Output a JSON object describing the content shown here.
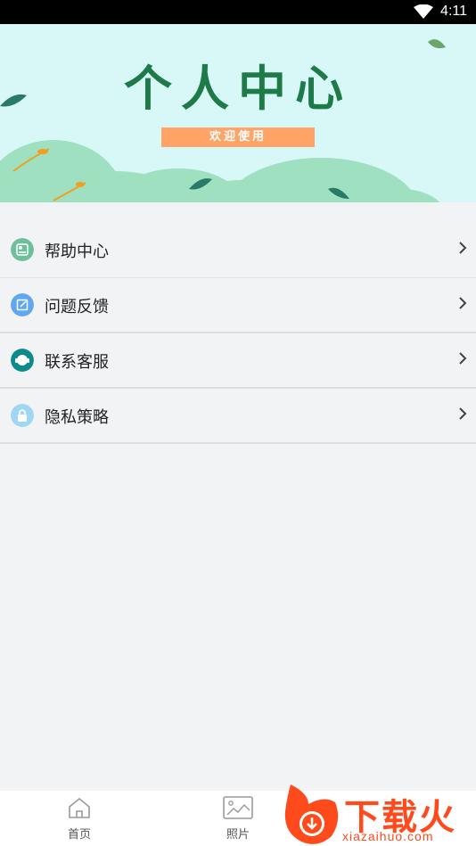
{
  "status_bar": {
    "time": "4:11"
  },
  "banner": {
    "title": "个人中心",
    "subtitle": "欢迎使用"
  },
  "menu": {
    "items": [
      {
        "label": "帮助中心",
        "icon": "help-center-icon",
        "color": "#6fbf9b"
      },
      {
        "label": "问题反馈",
        "icon": "feedback-icon",
        "color": "#5fa8ef"
      },
      {
        "label": "联系客服",
        "icon": "customer-service-icon",
        "color": "#0f8a8a"
      },
      {
        "label": "隐私策略",
        "icon": "privacy-lock-icon",
        "color": "#9ed6f3"
      }
    ]
  },
  "bottom_nav": {
    "items": [
      {
        "label": "首页",
        "icon": "home-icon"
      },
      {
        "label": "照片",
        "icon": "photo-icon"
      }
    ]
  },
  "watermark": {
    "text": "下载火",
    "url": "xiazaihuo.com"
  },
  "colors": {
    "accent": "#1f7a4a",
    "banner_bg": "#d8f8f8",
    "badge": "#ffa366",
    "watermark": "#ff4a1c"
  }
}
